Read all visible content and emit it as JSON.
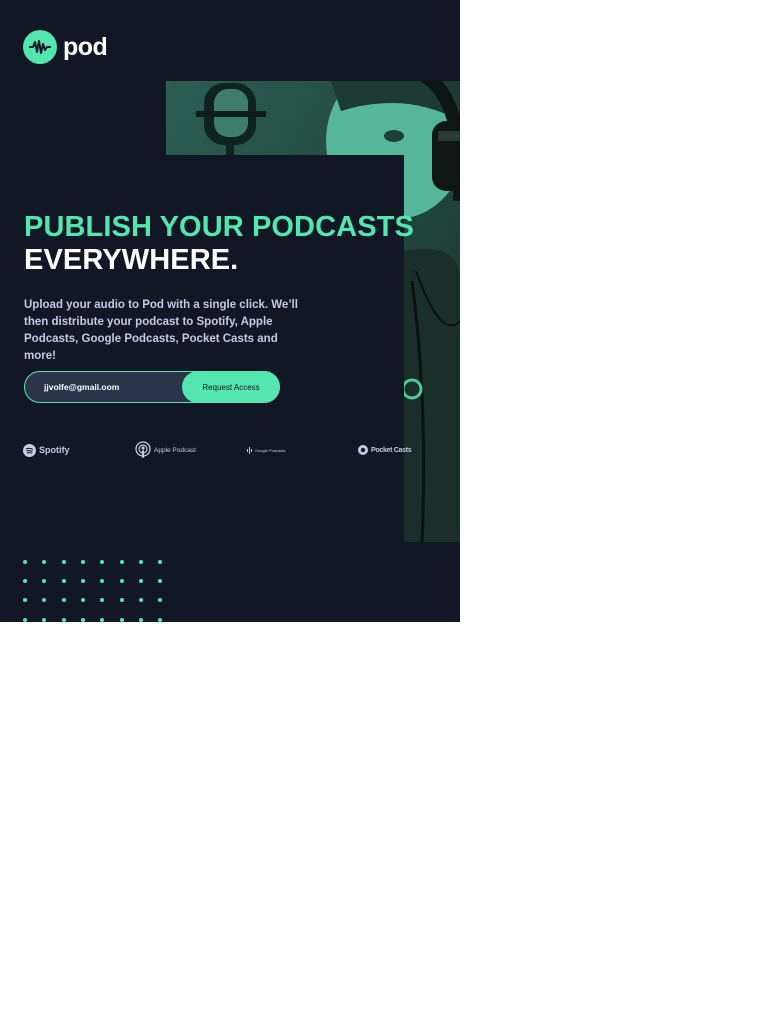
{
  "brand": {
    "name": "pod",
    "accent": "#54E6AF",
    "background": "#121725"
  },
  "hero": {
    "headline_line1": "PUBLISH YOUR PODCASTS",
    "headline_line2": "EVERYWHERE.",
    "description": "Upload your audio to Pod with a single click. We’ll then distribute your podcast to Spotify, Apple Podcasts, Google Podcasts, Pocket Casts and more!"
  },
  "form": {
    "email_value": "jjvolfe@gmail.oom",
    "button_label": "Request Access"
  },
  "platforms": [
    {
      "name": "Spotify",
      "icon": "spotify-icon"
    },
    {
      "name": "Apple Podcast",
      "icon": "apple-podcast-icon"
    },
    {
      "name": "Google Podcasts",
      "icon": "google-podcasts-icon"
    },
    {
      "name": "Pocket Casts",
      "icon": "pocket-casts-icon"
    }
  ],
  "photo": {
    "subject": "podcaster with headphones at microphone",
    "icon": "microphone-icon"
  }
}
